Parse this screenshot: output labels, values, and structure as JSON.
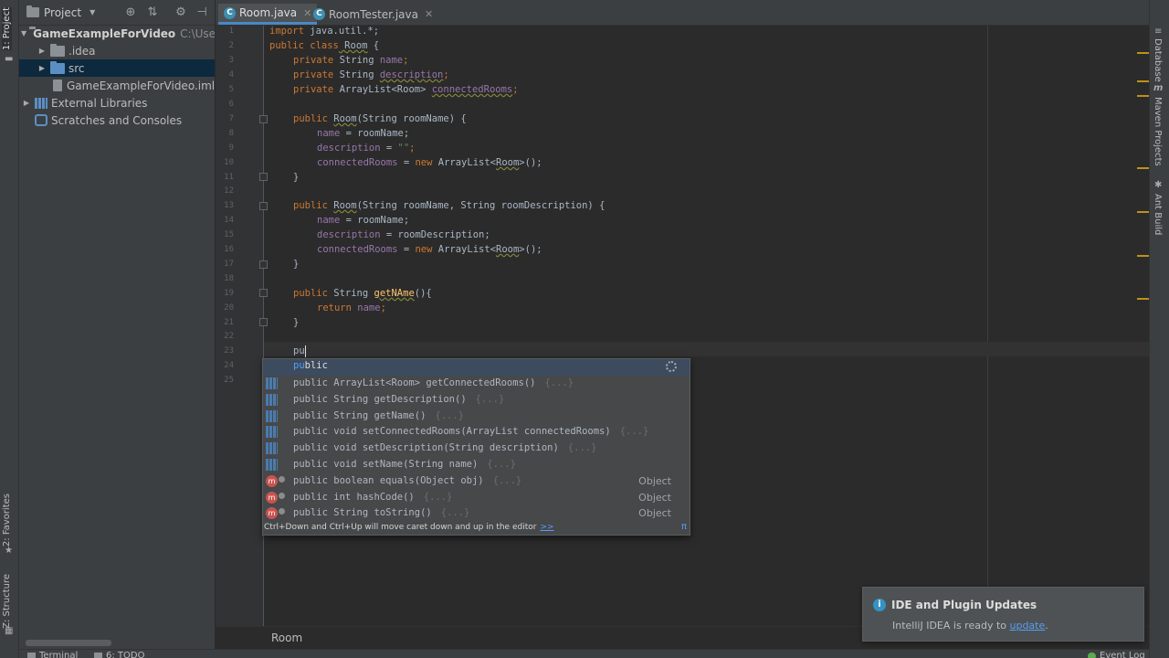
{
  "left_stripe": {
    "project_tab": "1: Project",
    "favorites_tab": "2: Favorites",
    "structure_tab": "Z: Structure"
  },
  "project_panel": {
    "title": "Project",
    "tree": [
      {
        "label": "GameExampleForVideo",
        "extra": "C:\\Users\\M",
        "expanded": true
      },
      {
        "label": ".idea"
      },
      {
        "label": "src",
        "selected": true
      },
      {
        "label": "GameExampleForVideo.iml"
      },
      {
        "label": "External Libraries"
      },
      {
        "label": "Scratches and Consoles"
      }
    ]
  },
  "tabs": [
    {
      "label": "Room.java",
      "active": true
    },
    {
      "label": "RoomTester.java",
      "active": false
    }
  ],
  "editor": {
    "line_numbers": [
      "1",
      "2",
      "3",
      "4",
      "5",
      "6",
      "7",
      "8",
      "9",
      "10",
      "11",
      "12",
      "13",
      "14",
      "15",
      "16",
      "17",
      "18",
      "19",
      "20",
      "21",
      "22",
      "23",
      "24",
      "25"
    ],
    "code": {
      "l1_a": "import",
      "l1_b": " java.util.*;",
      "l2_a": "public class",
      "l2_b": " Room",
      "l2_c": " {",
      "l3_a": "private",
      "l3_b": " String ",
      "l3_c": "name",
      "l3_d": ";",
      "l4_a": "private",
      "l4_b": " String ",
      "l4_c": "description",
      "l4_d": ";",
      "l5_a": "private",
      "l5_b": " ArrayList<Room> ",
      "l5_c": "connectedRooms",
      "l5_d": ";",
      "l7_a": "public",
      "l7_b": " ",
      "l7_c": "Room",
      "l7_d": "(String roomName) {",
      "l8_a": "name",
      "l8_b": " = roomName;",
      "l9_a": "description",
      "l9_b": " = ",
      "l9_c": "\"\"",
      "l9_d": ";",
      "l10_a": "connectedRooms",
      "l10_b": " = ",
      "l10_c": "new",
      "l10_d": " ArrayList<",
      "l10_e": "Room",
      "l10_f": ">();",
      "l11": "}",
      "l13_a": "public",
      "l13_b": " ",
      "l13_c": "Room",
      "l13_d": "(String roomName, String roomDescription) {",
      "l14_a": "name",
      "l14_b": " = roomName;",
      "l15_a": "description",
      "l15_b": " = roomDescription;",
      "l16_a": "connectedRooms",
      "l16_b": " = ",
      "l16_c": "new",
      "l16_d": " ArrayList<",
      "l16_e": "Room",
      "l16_f": ">();",
      "l17": "}",
      "l19_a": "public",
      "l19_b": " String ",
      "l19_c": "getNAme",
      "l19_d": "(){",
      "l20_a": "return",
      "l20_b": " ",
      "l20_c": "name",
      "l20_d": ";",
      "l21": "}",
      "l23": "pu"
    }
  },
  "completion": {
    "first": {
      "match": "pu",
      "rest": "blic"
    },
    "items": [
      {
        "text": "public ArrayList<Room> getConnectedRooms()",
        "hint": "{...}",
        "type": ""
      },
      {
        "text": "public String getDescription()",
        "hint": "{...}",
        "type": ""
      },
      {
        "text": "public String getName()",
        "hint": "{...}",
        "type": ""
      },
      {
        "text": "public void setConnectedRooms(ArrayList connectedRooms)",
        "hint": "{...}",
        "type": ""
      },
      {
        "text": "public void setDescription(String description)",
        "hint": "{...}",
        "type": ""
      },
      {
        "text": "public void setName(String name)",
        "hint": "{...}",
        "type": ""
      },
      {
        "text": "public boolean equals(Object obj)",
        "hint": "{...}",
        "type": "Object"
      },
      {
        "text": "public int hashCode()",
        "hint": "{...}",
        "type": "Object"
      },
      {
        "text": "public String toString()",
        "hint": "{...}",
        "type": "Object"
      }
    ],
    "footer": "Ctrl+Down and Ctrl+Up will move caret down and up in the editor",
    "footer_link": ">>",
    "pi": "π"
  },
  "breadcrumb": "Room",
  "right_stripe": {
    "database": "Database",
    "maven": "Maven Projects",
    "ant": "Ant Build"
  },
  "notification": {
    "title": "IDE and Plugin Updates",
    "body": "IntelliJ IDEA is ready to ",
    "link": "update",
    "tail": "."
  },
  "status_bar": {
    "terminal": "Terminal",
    "todo": "6: TODO",
    "event_log": "Event Log"
  }
}
